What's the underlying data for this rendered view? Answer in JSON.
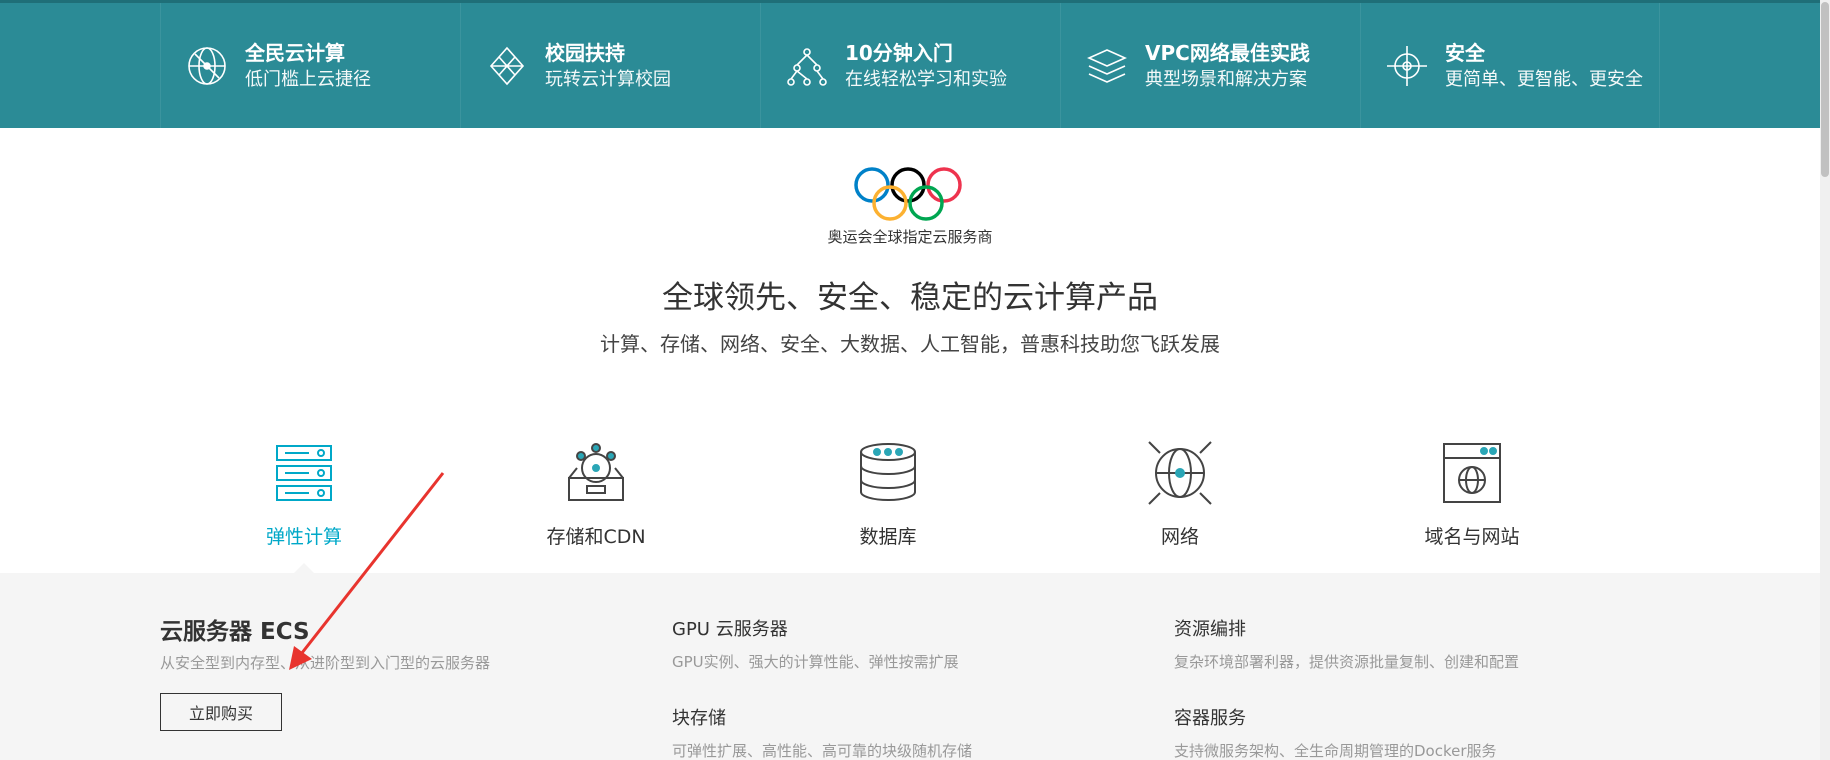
{
  "banner": {
    "items": [
      {
        "icon": "globe-network-icon",
        "title": "全民云计算",
        "subtitle": "低门槛上云捷径"
      },
      {
        "icon": "diamond-network-icon",
        "title": "校园扶持",
        "subtitle": "玩转云计算校园"
      },
      {
        "icon": "tree-nodes-icon",
        "title": "10分钟入门",
        "subtitle": "在线轻松学习和实验"
      },
      {
        "icon": "layers-network-icon",
        "title": "VPC网络最佳实践",
        "subtitle": "典型场景和解决方案"
      },
      {
        "icon": "shield-sphere-icon",
        "title": "安全",
        "subtitle": "更简单、更智能、更安全"
      }
    ]
  },
  "sponsor": {
    "caption": "奥运会全球指定云服务商"
  },
  "hero": {
    "title": "全球领先、安全、稳定的云计算产品",
    "subtitle": "计算、存储、网络、安全、大数据、人工智能，普惠科技助您飞跃发展"
  },
  "categories": [
    {
      "label": "弹性计算",
      "icon": "server-rack-icon",
      "active": true
    },
    {
      "label": "存储和CDN",
      "icon": "storage-disk-icon",
      "active": false
    },
    {
      "label": "数据库",
      "icon": "database-icon",
      "active": false
    },
    {
      "label": "网络",
      "icon": "network-globe-icon",
      "active": false
    },
    {
      "label": "域名与网站",
      "icon": "website-globe-icon",
      "active": false
    }
  ],
  "featured": {
    "title": "云服务器 ECS",
    "description": "从安全型到内存型、从进阶型到入门型的云服务器",
    "button": "立即购买"
  },
  "products": [
    {
      "title": "GPU 云服务器",
      "description": "GPU实例、强大的计算性能、弹性按需扩展"
    },
    {
      "title": "资源编排",
      "description": "复杂环境部署利器，提供资源批量复制、创建和配置"
    },
    {
      "title": "块存储",
      "description": "可弹性扩展、高性能、高可靠的块级随机存储"
    },
    {
      "title": "容器服务",
      "description": "支持微服务架构、全生命周期管理的Docker服务"
    }
  ],
  "colors": {
    "banner": "#2b8b96",
    "accent": "#00a8c8",
    "panel": "#f5f5f5",
    "annotation": "#e8342e"
  }
}
